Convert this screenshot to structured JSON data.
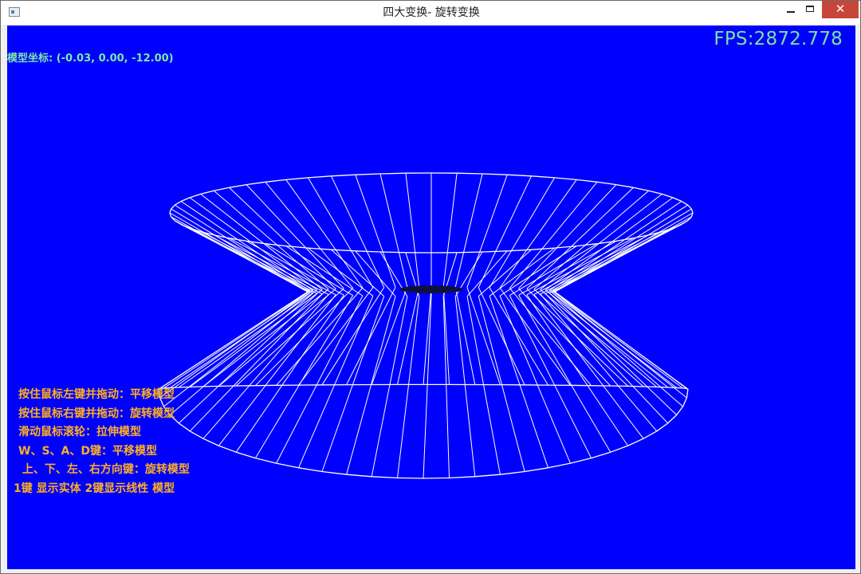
{
  "window": {
    "title": "四大变换- 旋转变换",
    "controls": {
      "minimize": "minimize",
      "maximize": "maximize",
      "close": "✕"
    }
  },
  "hud": {
    "fps": "FPS:2872.778",
    "model_coords": "模型坐标: (-0.03, 0.00, -12.00)"
  },
  "help": {
    "lines": [
      "按住鼠标左键并拖动：平移模型",
      "按住鼠标右键并拖动：旋转模型",
      "滑动鼠标滚轮：拉伸模型",
      "W、S、A、D键：平移模型",
      " 上、下、左、右方向键：旋转模型",
      "1键 显示实体  2键显示线性 模型"
    ]
  },
  "colors": {
    "viewport_bg": "#0000fe",
    "wireframe": "#ffffff",
    "fps_text": "#80e0a0",
    "help_text": "#ffb01e"
  }
}
